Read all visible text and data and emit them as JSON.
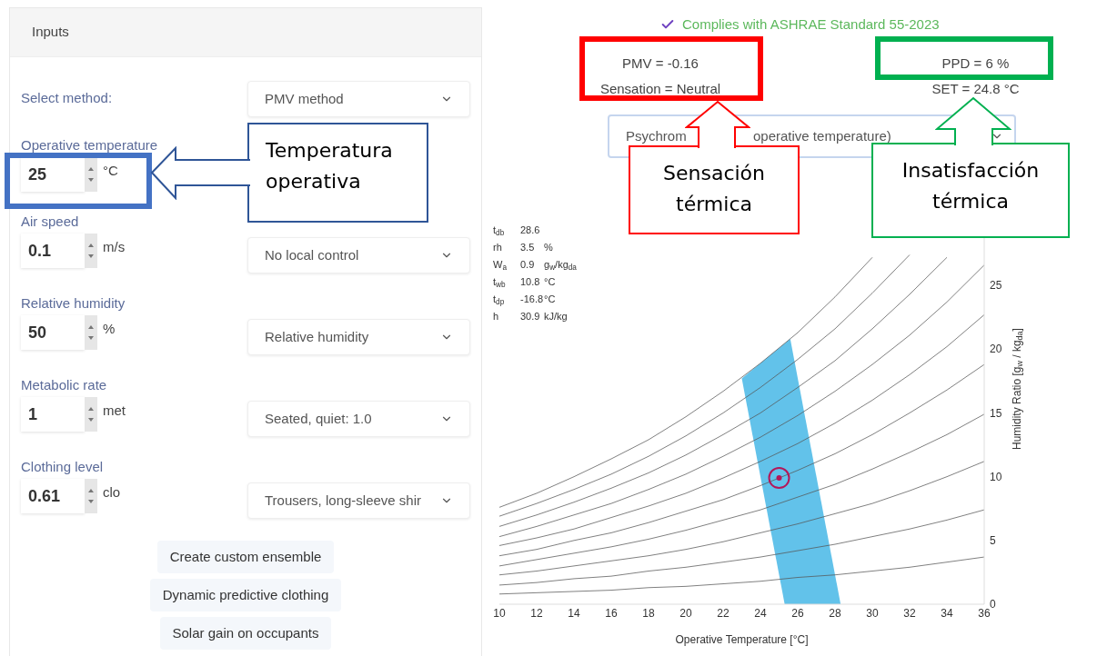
{
  "inputs_panel": {
    "title": "Inputs",
    "method": {
      "label": "Select method:",
      "select": "PMV method"
    },
    "fields": [
      {
        "label": "Operative temperature",
        "value": "25",
        "unit": "°C"
      },
      {
        "label": "Air speed",
        "value": "0.1",
        "unit": "m/s",
        "select": "No local control"
      },
      {
        "label": "Relative humidity",
        "value": "50",
        "unit": "%",
        "select": "Relative humidity"
      },
      {
        "label": "Metabolic rate",
        "value": "1",
        "unit": "met",
        "select": "Seated, quiet: 1.0"
      },
      {
        "label": "Clothing level",
        "value": "0.61",
        "unit": "clo",
        "select": "Trousers, long-sleeve shir"
      }
    ],
    "buttons": [
      "Create custom ensemble",
      "Dynamic predictive clothing",
      "Solar gain on occupants"
    ]
  },
  "results": {
    "compliance": "Complies with ASHRAE Standard 55-2023",
    "left": [
      "PMV = -0.16",
      "Sensation = Neutral"
    ],
    "right": [
      "PPD = 6 %",
      "SET = 24.8 °C"
    ],
    "chart_selector_parts": [
      "Psychrom",
      "operative temperature)"
    ]
  },
  "chart_info": [
    {
      "symbol": "t$_{db}$",
      "value": "28.6"
    },
    {
      "symbol": "rh",
      "value": "3.5",
      "unit": "%"
    },
    {
      "symbol": "W$_{a}$",
      "value": "0.9",
      "unit": "g$_{w}$/kg$_{da}$"
    },
    {
      "symbol": "t$_{wb}$",
      "value": "10.8",
      "unit": "°C"
    },
    {
      "symbol": "t$_{dp}$",
      "value": "-16.8",
      "unit": "°C"
    },
    {
      "symbol": "h",
      "value": "30.9",
      "unit": "kJ/kg"
    }
  ],
  "chart_data": {
    "type": "line",
    "xlabel": "Operative Temperature [°C]",
    "ylabel": "Humidity Ratio [g$_{w}$ / kg$_{da}$]",
    "xlim": [
      10,
      36
    ],
    "ylim": [
      0,
      30
    ],
    "xticks": [
      10,
      12,
      14,
      16,
      18,
      20,
      22,
      24,
      26,
      28,
      30,
      32,
      34,
      36
    ],
    "yticks": [
      0,
      5,
      10,
      15,
      20,
      25
    ],
    "x": [
      10,
      12,
      14,
      16,
      18,
      20,
      22,
      24,
      26,
      28,
      30,
      32,
      34,
      36
    ],
    "series": [
      {
        "color": "#555555",
        "values": [
          0.8,
          0.9,
          1.0,
          1.1,
          1.3,
          1.4,
          1.6,
          1.8,
          2.1,
          2.3,
          2.6,
          2.9,
          3.3,
          3.7
        ]
      },
      {
        "color": "#555555",
        "values": [
          1.5,
          1.7,
          2.0,
          2.2,
          2.6,
          2.9,
          3.3,
          3.7,
          4.2,
          4.7,
          5.3,
          5.9,
          6.6,
          7.4
        ]
      },
      {
        "color": "#555555",
        "values": [
          2.3,
          2.6,
          3.0,
          3.4,
          3.8,
          4.3,
          4.9,
          5.6,
          6.3,
          7.1,
          7.9,
          8.9,
          10.0,
          11.2
        ]
      },
      {
        "color": "#555555",
        "values": [
          3.0,
          3.5,
          4.0,
          4.5,
          5.1,
          5.8,
          6.6,
          7.4,
          8.4,
          9.4,
          10.6,
          11.9,
          13.3,
          14.9
        ]
      },
      {
        "color": "#555555",
        "values": [
          3.8,
          4.3,
          5.0,
          5.6,
          6.4,
          7.3,
          8.2,
          9.3,
          10.5,
          11.8,
          13.3,
          15.0,
          16.8,
          18.8
        ]
      },
      {
        "color": "#555555",
        "values": [
          4.6,
          5.2,
          5.9,
          6.8,
          7.7,
          8.7,
          9.9,
          11.2,
          12.6,
          14.2,
          16.0,
          18.0,
          20.2,
          22.7
        ]
      },
      {
        "color": "#555555",
        "values": [
          5.3,
          6.1,
          7.0,
          7.9,
          9.0,
          10.2,
          11.6,
          13.1,
          14.8,
          16.7,
          18.8,
          21.1,
          23.7,
          26.6
        ]
      },
      {
        "color": "#555555",
        "values": [
          6.1,
          7.0,
          8.0,
          9.1,
          10.3,
          11.7,
          13.3,
          15.0,
          17.0,
          19.1,
          21.6,
          24.3,
          27.2,
          null
        ]
      },
      {
        "color": "#555555",
        "values": [
          6.9,
          7.9,
          9.0,
          10.2,
          11.6,
          13.2,
          15.0,
          17.0,
          19.2,
          21.6,
          24.4,
          27.4,
          null,
          null
        ]
      },
      {
        "color": "#555555",
        "values": [
          7.6,
          8.7,
          10.0,
          11.4,
          12.9,
          14.7,
          16.7,
          18.9,
          21.3,
          24.1,
          27.2,
          null,
          null,
          null
        ]
      }
    ]
  },
  "highlights": [
    {
      "color": "#4472c4"
    },
    {
      "color": "#ff0000"
    },
    {
      "color": "#00b050"
    }
  ],
  "callouts": [
    {
      "text": "Temperatura operativa",
      "color": "#2f5597"
    },
    {
      "text": "Sensación térmica",
      "color": "#ff0000"
    },
    {
      "text": "Insatisfacción térmica",
      "color": "#00b050"
    }
  ]
}
